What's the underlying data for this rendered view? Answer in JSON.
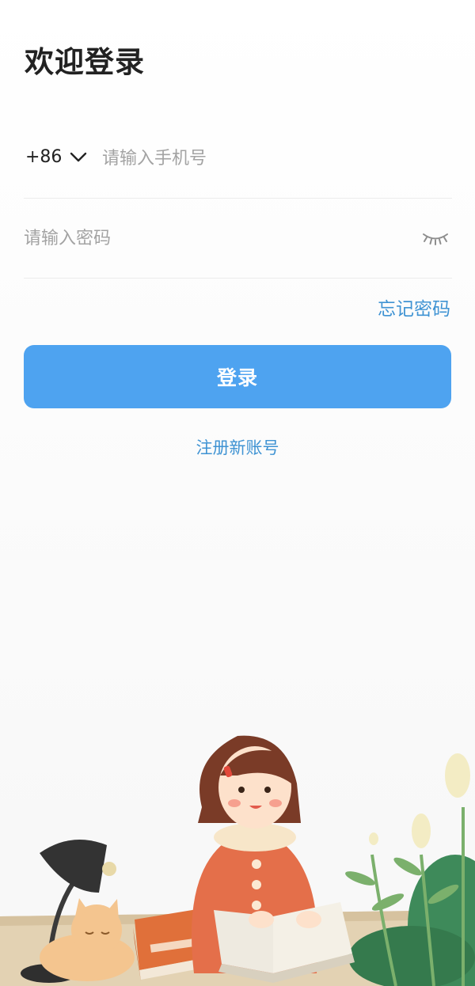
{
  "login": {
    "title": "欢迎登录",
    "phone": {
      "country_code": "+86",
      "placeholder": "请输入手机号",
      "value": ""
    },
    "password": {
      "placeholder": "请输入密码",
      "value": ""
    },
    "forgot_label": "忘记密码",
    "submit_label": "登录",
    "register_label": "注册新账号"
  },
  "colors": {
    "accent": "#4ea3f0",
    "link": "#3f93d3"
  },
  "icons": {
    "country_dropdown": "chevron-down-icon",
    "password_visibility": "eye-closed-icon"
  }
}
